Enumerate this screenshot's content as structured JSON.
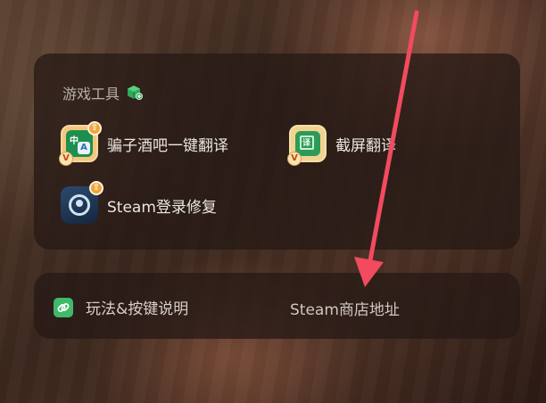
{
  "panel": {
    "title": "游戏工具",
    "tools": [
      {
        "label": "骗子酒吧一键翻译",
        "icon": "translate-app-icon"
      },
      {
        "label": "截屏翻译",
        "icon": "screenshot-translate-app-icon"
      },
      {
        "label": "Steam登录修复",
        "icon": "steam-app-icon"
      }
    ]
  },
  "links": {
    "guide_label": "玩法&按键说明",
    "store_label": "Steam商店地址"
  },
  "icon_text": {
    "zh": "中",
    "a": "A",
    "v": "V",
    "up": "⇧",
    "yi": "译"
  },
  "colors": {
    "panel_bg": "#261a16",
    "accent_green": "#3fb96a",
    "arrow_red": "#f24a5e"
  }
}
